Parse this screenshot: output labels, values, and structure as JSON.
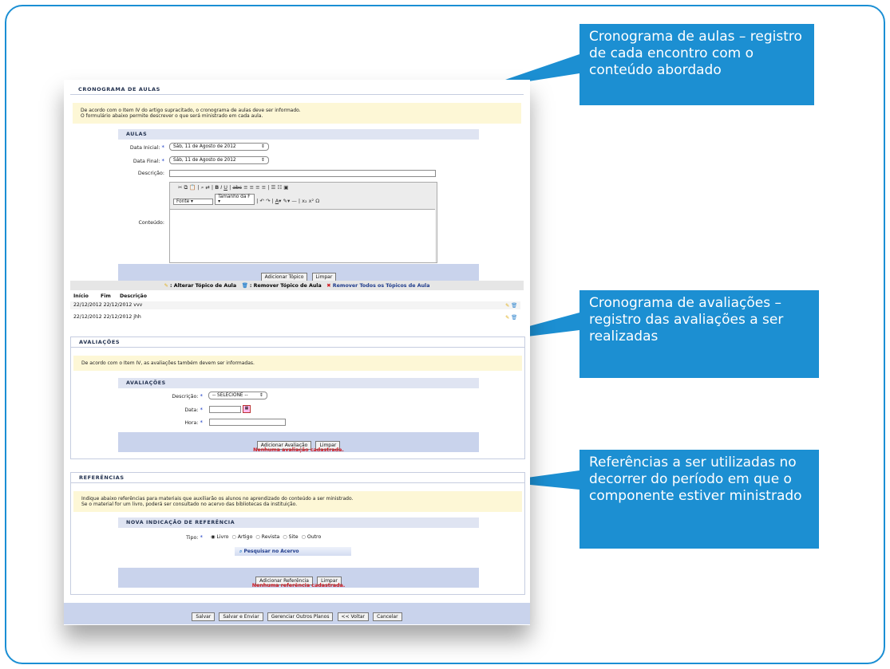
{
  "callouts": {
    "aulas": "Cronograma de aulas – registro de cada encontro com o conteúdo abordado",
    "avaliacoes": "Cronograma de avaliações – registro das avaliações a ser realizadas",
    "referencias": "Referências a ser utilizadas no decorrer do período em que o componente estiver ministrado"
  },
  "aulas_section": {
    "title": "Cronograma de Aulas",
    "message_line1": "De acordo com o Item IV do artigo supracitado, o cronograma de aulas deve ser informado.",
    "message_line2": "O formulário abaixo permite descrever o que será ministrado em cada aula.",
    "box_title": "Aulas",
    "data_inicial_label": "Data Inicial:",
    "data_inicial_value": "Sáb, 11 de Agosto de 2012",
    "data_final_label": "Data Final:",
    "data_final_value": "Sáb, 11 de Agosto de 2012",
    "descricao_label": "Descrição:",
    "conteudo_label": "Conteúdo:",
    "fonte_value": "Fonte",
    "tamanho_value": "Tamanho da F",
    "add_topic_button": "Adicionar Tópico",
    "clear_button": "Limpar",
    "legend_alterar": ": Alterar Tópico de Aula",
    "legend_remover": ": Remover Tópico de Aula",
    "legend_remover_todos": "Remover Todos os Tópicos de Aula",
    "table_headers": [
      "Início",
      "Fim",
      "Descrição"
    ],
    "rows": [
      {
        "inicio": "22/12/2012",
        "fim": "22/12/2012",
        "descricao": "vvv"
      },
      {
        "inicio": "22/12/2012",
        "fim": "22/12/2012",
        "descricao": "jhh"
      }
    ]
  },
  "avaliacoes_section": {
    "title": "Avaliações",
    "message": "De acordo com o Item IV, as avaliações também devem ser informadas.",
    "box_title": "Avaliações",
    "descricao_label": "Descrição:",
    "descricao_value": "-- SELECIONE --",
    "data_label": "Data:",
    "hora_label": "Hora:",
    "add_button": "Adicionar Avaliação",
    "clear_button": "Limpar",
    "empty_message": "Nenhuma avaliação cadastrada."
  },
  "referencias_section": {
    "title": "Referências",
    "message_line1": "Indique abaixo referências para materiais que auxiliarão os alunos no aprendizado do conteúdo a ser ministrado.",
    "message_line2": "Se o material for um livro, poderá ser consultado no acervo das bibliotecas da instituição.",
    "box_title": "Nova Indicação de Referência",
    "tipo_label": "Tipo:",
    "tipo_options": [
      "Livro",
      "Artigo",
      "Revista",
      "Site",
      "Outro"
    ],
    "tipo_selected": "Livro",
    "search_button": "Pesquisar no Acervo",
    "add_button": "Adicionar Referência",
    "clear_button": "Limpar",
    "empty_message": "Nenhuma referência cadastrada."
  },
  "footer_buttons": {
    "salvar": "Salvar",
    "salvar_enviar": "Salvar e Enviar",
    "gerenciar": "Gerenciar Outros Planos",
    "voltar": "<< Voltar",
    "cancelar": "Cancelar"
  },
  "colors": {
    "callout_bg": "#1c8fd2",
    "frame_border": "#1b8fd4",
    "error_text": "#d0181f",
    "required_star": "#1a3cc4"
  }
}
